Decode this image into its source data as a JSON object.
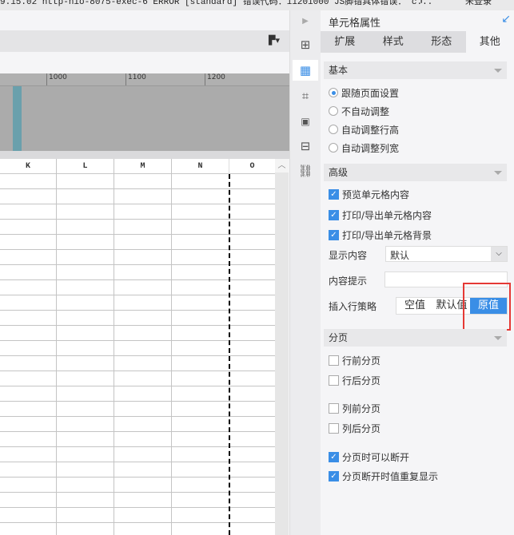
{
  "status_bar": {
    "text": "9.15.02 http-nio-8075-exec-6 ERROR [standard] 错误代码：11201000 JS脚错具体错误：  c...",
    "login": "未登录"
  },
  "ruler": {
    "ticks": [
      "1000",
      "1100",
      "1200"
    ]
  },
  "sheet": {
    "columns": [
      "K",
      "L",
      "M",
      "N",
      "O"
    ]
  },
  "panel": {
    "title": "单元格属性",
    "tabs": [
      {
        "label": "扩展"
      },
      {
        "label": "样式"
      },
      {
        "label": "形态"
      },
      {
        "label": "其他",
        "active": true
      }
    ],
    "basic": {
      "title": "基本",
      "options": [
        {
          "label": "跟随页面设置",
          "checked": true
        },
        {
          "label": "不自动调整",
          "checked": false
        },
        {
          "label": "自动调整行高",
          "checked": false
        },
        {
          "label": "自动调整列宽",
          "checked": false
        }
      ]
    },
    "advanced": {
      "title": "高级",
      "checks": [
        {
          "label": "预览单元格内容",
          "checked": true
        },
        {
          "label": "打印/导出单元格内容",
          "checked": true
        },
        {
          "label": "打印/导出单元格背景",
          "checked": true
        }
      ],
      "display_label": "显示内容",
      "display_value": "默认",
      "tooltip_label": "内容提示",
      "tooltip_value": "",
      "insert_label": "插入行策略",
      "insert_options": [
        "空值",
        "默认值",
        "原值"
      ],
      "insert_selected": "原值"
    },
    "paging": {
      "title": "分页",
      "checks": [
        {
          "label": "行前分页",
          "checked": false
        },
        {
          "label": "行后分页",
          "checked": false
        },
        {
          "label": "列前分页",
          "checked": false
        },
        {
          "label": "列后分页",
          "checked": false
        },
        {
          "label": "分页时可以断开",
          "checked": true
        },
        {
          "label": "分页断开时值重复显示",
          "checked": true
        }
      ]
    }
  },
  "colors": {
    "accent": "#3a8ee6",
    "highlight": "#e53935",
    "teal": "#6aa0ac"
  }
}
